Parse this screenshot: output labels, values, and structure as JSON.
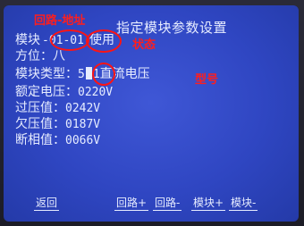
{
  "screen": {
    "title": "指定模块参数设置",
    "module_label": "模块",
    "module_address": "-01-01",
    "status": "使用",
    "orientation_label": "方位：",
    "orientation_value": "八",
    "type_label": "模块类型：",
    "type_code_prefix": "5",
    "type_code_suffix": "1",
    "type_name": "直流电压",
    "rated_voltage_label": "额定电压：",
    "rated_voltage_value": "0220V",
    "over_voltage_label": "过压值：",
    "over_voltage_value": "0242V",
    "under_voltage_label": "欠压值：",
    "under_voltage_value": "0187V",
    "phase_loss_label": "断相值：",
    "phase_loss_value": "0066V"
  },
  "annotations": {
    "loop_address": "回路-地址",
    "status": "状态",
    "type": "型号",
    "color": "#ff1e1e"
  },
  "softkeys": {
    "back": "返回",
    "loop_plus": "回路+",
    "loop_minus": "回路-",
    "module_plus": "模块+",
    "module_minus": "模块-"
  }
}
